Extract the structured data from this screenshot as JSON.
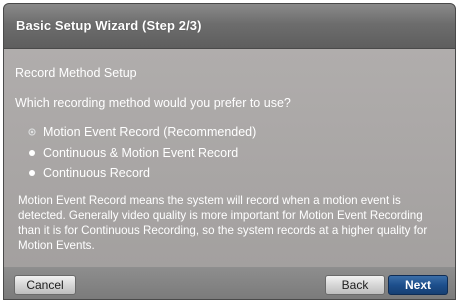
{
  "window": {
    "title": "Basic Setup Wizard (Step 2/3)"
  },
  "content": {
    "heading": "Record Method Setup",
    "question": "Which recording method would you prefer to use?",
    "options": [
      {
        "label": "Motion Event Record (Recommended)",
        "selected": true
      },
      {
        "label": "Continuous & Motion Event Record",
        "selected": false
      },
      {
        "label": "Continuous Record",
        "selected": false
      }
    ],
    "description": "Motion Event Record means the system will record when a motion event is detected. Generally video quality is more important for Motion Event Recording than it is for Continuous Recording, so the system records at a higher quality for Motion Events."
  },
  "footer": {
    "cancel_label": "Cancel",
    "back_label": "Back",
    "next_label": "Next"
  },
  "colors": {
    "title_bar": "#6d6d6d",
    "body_bg": "#a9a6a5",
    "primary_button": "#1d4f8c",
    "text": "#ffffff"
  }
}
